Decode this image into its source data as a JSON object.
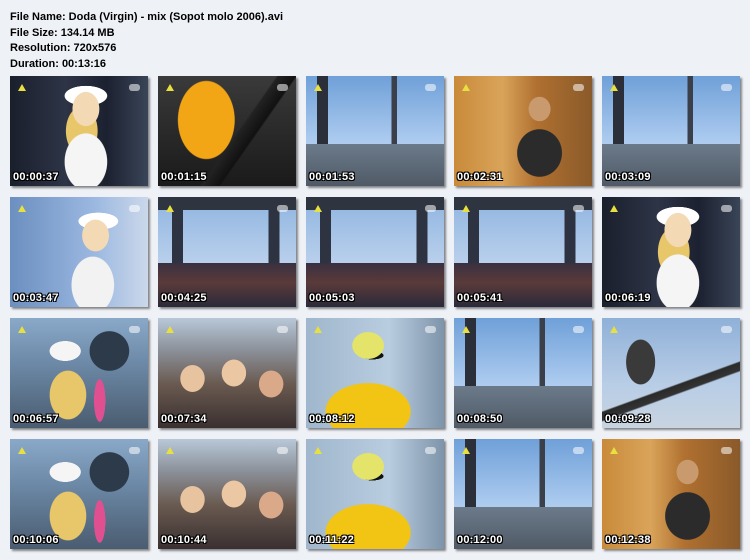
{
  "file_info": {
    "name": "File Name: Doda (Virgin) - mix (Sopot molo 2006).avi",
    "size": "File Size: 134.14 MB",
    "resolution": "Resolution: 720x576",
    "duration": "Duration: 00:13:16"
  },
  "thumbnails": [
    {
      "time": "00:00:37",
      "scene": "singer-closeup-dark"
    },
    {
      "time": "00:01:15",
      "scene": "guitar-orange"
    },
    {
      "time": "00:01:53",
      "scene": "stage-sky"
    },
    {
      "time": "00:02:31",
      "scene": "drummer-warm"
    },
    {
      "time": "00:03:09",
      "scene": "stage-sky"
    },
    {
      "time": "00:03:47",
      "scene": "singer-sky"
    },
    {
      "time": "00:04:25",
      "scene": "crowd-stage-wide"
    },
    {
      "time": "00:05:03",
      "scene": "crowd-stage-wide"
    },
    {
      "time": "00:05:41",
      "scene": "crowd-stage-wide"
    },
    {
      "time": "00:06:19",
      "scene": "singer-closeup-dark"
    },
    {
      "time": "00:06:57",
      "scene": "singer-back-drums"
    },
    {
      "time": "00:07:34",
      "scene": "crowd-closeup"
    },
    {
      "time": "00:08:12",
      "scene": "guitarist-yellow"
    },
    {
      "time": "00:08:50",
      "scene": "stage-sky"
    },
    {
      "time": "00:09:28",
      "scene": "bassist-sky"
    },
    {
      "time": "00:10:06",
      "scene": "singer-back-drums"
    },
    {
      "time": "00:10:44",
      "scene": "crowd-closeup"
    },
    {
      "time": "00:11:22",
      "scene": "guitarist-yellow"
    },
    {
      "time": "00:12:00",
      "scene": "stage-sky"
    },
    {
      "time": "00:12:38",
      "scene": "drummer-warm"
    }
  ]
}
